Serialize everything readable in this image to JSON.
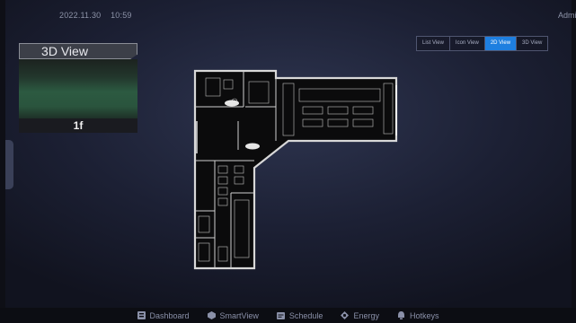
{
  "header": {
    "date": "2022.11.30",
    "time": "10:59",
    "user": "Admin"
  },
  "view_card": {
    "title": "3D View",
    "floor": "1f"
  },
  "view_switch": {
    "options": [
      "List View",
      "Icon View",
      "2D View",
      "3D View"
    ],
    "active": "2D View",
    "active_color": "#1e7fe0"
  },
  "bottom_nav": {
    "items": [
      {
        "label": "Dashboard",
        "icon": "dashboard-icon"
      },
      {
        "label": "SmartView",
        "icon": "smartview-icon"
      },
      {
        "label": "Schedule",
        "icon": "schedule-icon"
      },
      {
        "label": "Energy",
        "icon": "energy-icon"
      },
      {
        "label": "Hotkeys",
        "icon": "hotkeys-icon"
      }
    ]
  }
}
